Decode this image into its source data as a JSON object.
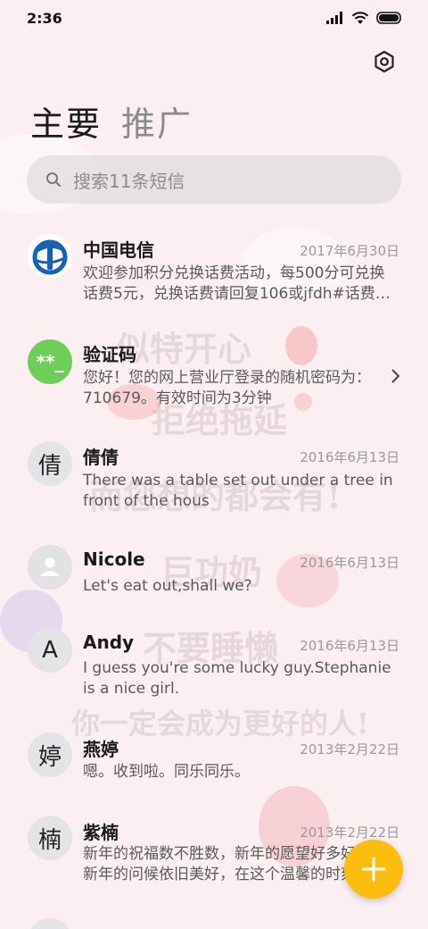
{
  "status": {
    "time": "2:36"
  },
  "tabs": {
    "primary": "主要",
    "promo": "推广"
  },
  "search": {
    "placeholder": "搜索11条短信"
  },
  "colors": {
    "accent": "#fbbd0f",
    "verify_avatar": "#6fce58",
    "telecom_blue": "#1760b8"
  },
  "conversations": [
    {
      "name": "中国电信",
      "date": "2017年6月30日",
      "preview": "欢迎参加积分兑换话费活动，每500分可兑换话费5元，兑换话费请回复106或jfdh#话费…",
      "avatar_icon": "china-telecom-logo-icon"
    },
    {
      "name": "验证码",
      "preview": "您好！您的网上营业厅登录的随机密码为：710679。有效时间为3分钟",
      "avatar_text": "**_",
      "icon": "chevron-right-icon"
    },
    {
      "name": "倩倩",
      "date": "2016年6月13日",
      "preview": "There was a table set out under a tree in front of the hous",
      "avatar_text": "倩"
    },
    {
      "name": "Nicole",
      "date": "2016年6月13日",
      "preview": "Let's eat out,shall we?",
      "avatar_icon": "person-icon"
    },
    {
      "name": "Andy",
      "date": "2016年6月13日",
      "preview": "I guess you're some lucky guy.Stephanie is a nice girl.",
      "avatar_text": "A"
    },
    {
      "name": "燕婷",
      "date": "2013年2月22日",
      "preview": "嗯。收到啦。同乐同乐。",
      "avatar_text": "婷"
    },
    {
      "name": "紫楠",
      "date": "2013年2月22日",
      "preview": "新年的祝福数不胜数，新年的愿望好多好多，新年的问候依旧美好，在这个温馨的时刻",
      "avatar_text": "楠"
    }
  ],
  "fab": {
    "icon": "plus-icon"
  }
}
